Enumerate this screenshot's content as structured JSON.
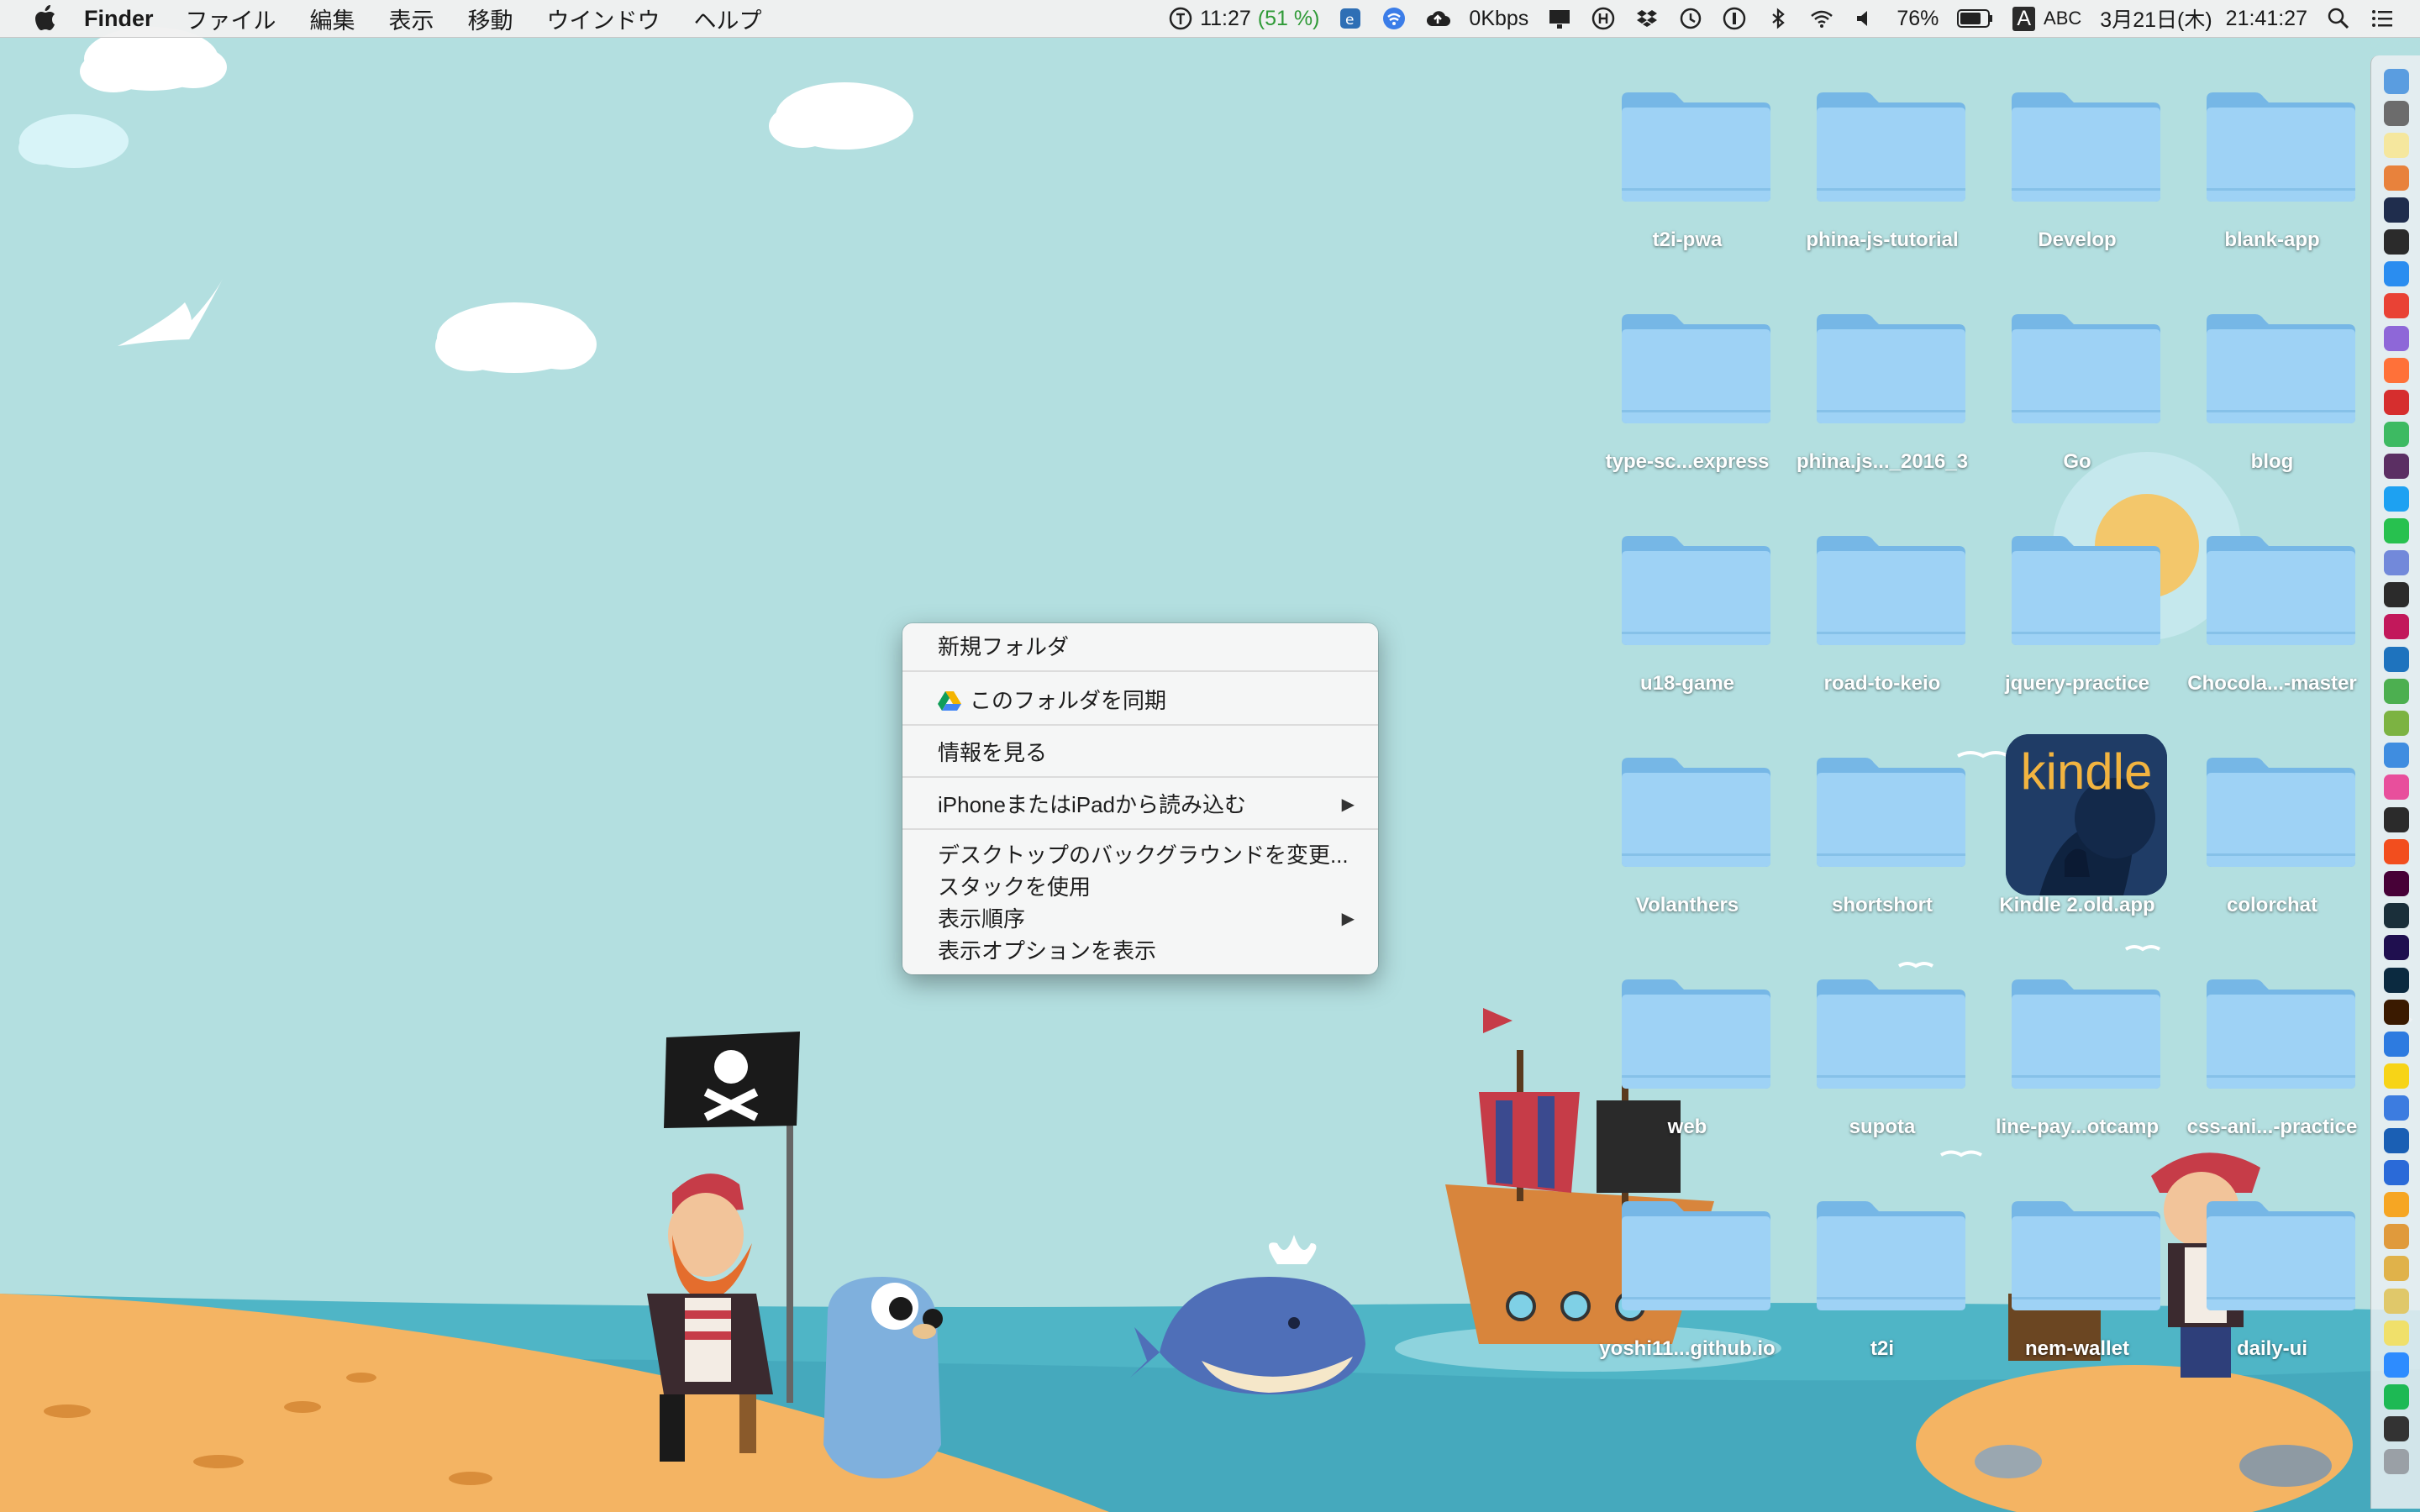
{
  "menubar": {
    "app_name": "Finder",
    "menus": [
      "ファイル",
      "編集",
      "表示",
      "移動",
      "ウインドウ",
      "ヘルプ"
    ],
    "status": {
      "timer": "11:27",
      "timer_pct": "(51 %)",
      "network_speed": "0Kbps",
      "battery": "76%",
      "input_source": "A",
      "input_label": "ABC",
      "date": "3月21日(木)",
      "time": "21:41:27"
    }
  },
  "desktop": {
    "icons": [
      {
        "label": "t2i-pwa",
        "type": "folder"
      },
      {
        "label": "phina-js-tutorial",
        "type": "folder"
      },
      {
        "label": "Develop",
        "type": "folder"
      },
      {
        "label": "blank-app",
        "type": "folder"
      },
      {
        "label": "type-sc...express",
        "type": "folder"
      },
      {
        "label": "phina.js..._2016_3",
        "type": "folder"
      },
      {
        "label": "Go",
        "type": "folder"
      },
      {
        "label": "blog",
        "type": "folder"
      },
      {
        "label": "u18-game",
        "type": "folder"
      },
      {
        "label": "road-to-keio",
        "type": "folder"
      },
      {
        "label": "jquery-practice",
        "type": "folder"
      },
      {
        "label": "Chocola...-master",
        "type": "folder"
      },
      {
        "label": "Volanthers",
        "type": "folder"
      },
      {
        "label": "shortshort",
        "type": "folder"
      },
      {
        "label": "Kindle 2.old.app",
        "type": "app",
        "app_text": "kindle"
      },
      {
        "label": "colorchat",
        "type": "folder"
      },
      {
        "label": "web",
        "type": "folder"
      },
      {
        "label": "supota",
        "type": "folder"
      },
      {
        "label": "line-pay...otcamp",
        "type": "folder"
      },
      {
        "label": "css-ani...-practice",
        "type": "folder"
      },
      {
        "label": "yoshi11...github.io",
        "type": "folder"
      },
      {
        "label": "t2i",
        "type": "folder"
      },
      {
        "label": "nem-wallet",
        "type": "folder"
      },
      {
        "label": "daily-ui",
        "type": "folder"
      }
    ]
  },
  "context_menu": {
    "new_folder": "新規フォルダ",
    "sync_folder": "このフォルダを同期",
    "get_info": "情報を見る",
    "import_from_iphone": "iPhoneまたはiPadから読み込む",
    "change_background": "デスクトップのバックグラウンドを変更...",
    "use_stacks": "スタックを使用",
    "sort_by": "表示順序",
    "show_view_options": "表示オプションを表示"
  },
  "dock": {
    "icons": [
      "finder-icon",
      "rocket-icon",
      "notes-icon",
      "photos-icon",
      "quicktime-icon",
      "terminal-icon",
      "app-store-icon",
      "chrome-icon",
      "app-icon",
      "firefox-icon",
      "opera-icon",
      "app-icon",
      "slack-icon",
      "twitter-icon",
      "line-icon",
      "discord-icon",
      "app-icon",
      "intellij-icon",
      "vscode-icon",
      "app-icon",
      "android-icon",
      "xcode-icon",
      "itunes-icon",
      "app-icon",
      "figma-icon",
      "xd-icon",
      "lightroom-icon",
      "after-effects-icon",
      "photoshop-icon",
      "illustrator-icon",
      "app-icon",
      "kakao-icon",
      "app-icon",
      "1password-icon",
      "app-icon",
      "sketch-icon",
      "app-icon",
      "books-icon",
      "app-icon",
      "app-icon",
      "zoom-icon",
      "spotify-icon",
      "app-icon",
      "trash-icon"
    ]
  },
  "colors": {
    "sky": "#b3dfe0",
    "sea": "#4fb5c6",
    "sand": "#f4b463",
    "folder": "#8fc9ef"
  }
}
